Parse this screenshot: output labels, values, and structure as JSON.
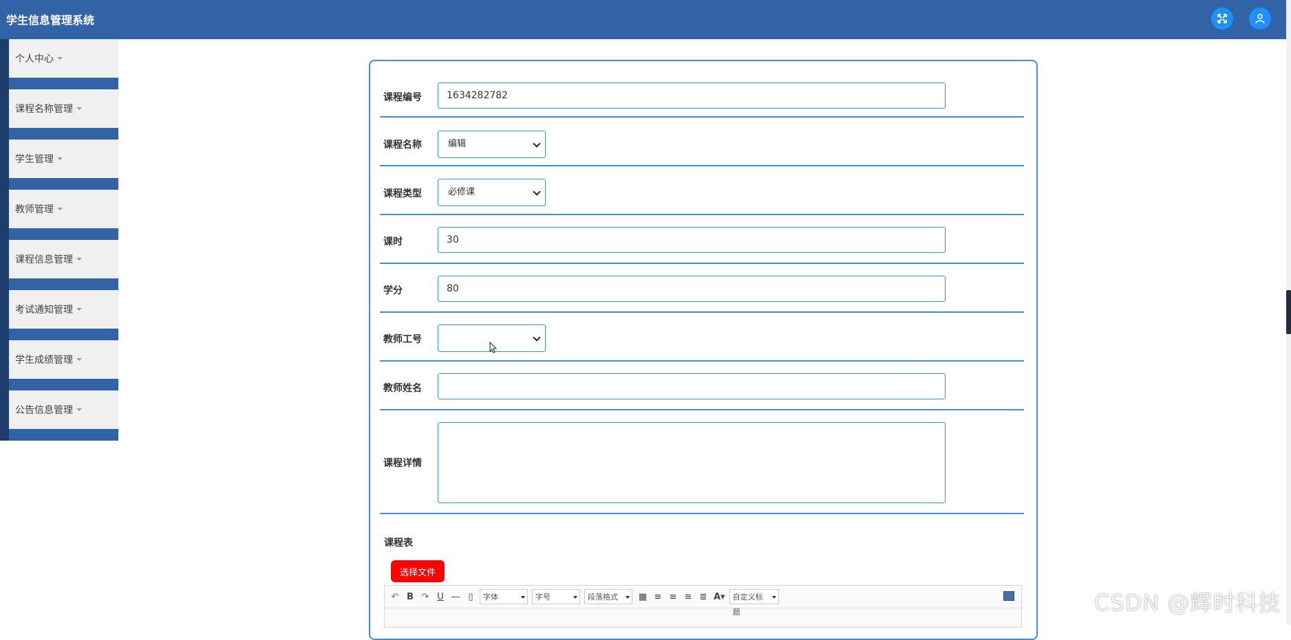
{
  "app": {
    "title": "学生信息管理系统"
  },
  "sidebar": {
    "items": [
      {
        "label": "个人中心"
      },
      {
        "label": "课程名称管理"
      },
      {
        "label": "学生管理"
      },
      {
        "label": "教师管理"
      },
      {
        "label": "课程信息管理"
      },
      {
        "label": "考试通知管理"
      },
      {
        "label": "学生成绩管理"
      },
      {
        "label": "公告信息管理"
      }
    ]
  },
  "form": {
    "course_no": {
      "label": "课程编号",
      "value": "1634282782"
    },
    "course_name": {
      "label": "课程名称",
      "value": "编辑"
    },
    "course_type": {
      "label": "课程类型",
      "value": "必修课"
    },
    "hours": {
      "label": "课时",
      "value": "30"
    },
    "credit": {
      "label": "学分",
      "value": "80"
    },
    "teacher_no": {
      "label": "教师工号",
      "value": ""
    },
    "teacher_name": {
      "label": "教师姓名",
      "value": ""
    },
    "detail": {
      "label": "课程详情",
      "value": ""
    },
    "schedule": {
      "label": "课程表",
      "button": "选择文件"
    }
  },
  "editor": {
    "font_label": "字体",
    "size_label": "字号",
    "paragraph_label": "段落格式",
    "custom_title_label": "自定义标题"
  },
  "watermark": "CSDN @辉时科技",
  "icons": {
    "fullscreen": "expand-icon",
    "user": "user-icon"
  },
  "colors": {
    "primary": "#3163a6",
    "accent": "#3a8ee6",
    "button_red": "#ff0000"
  }
}
